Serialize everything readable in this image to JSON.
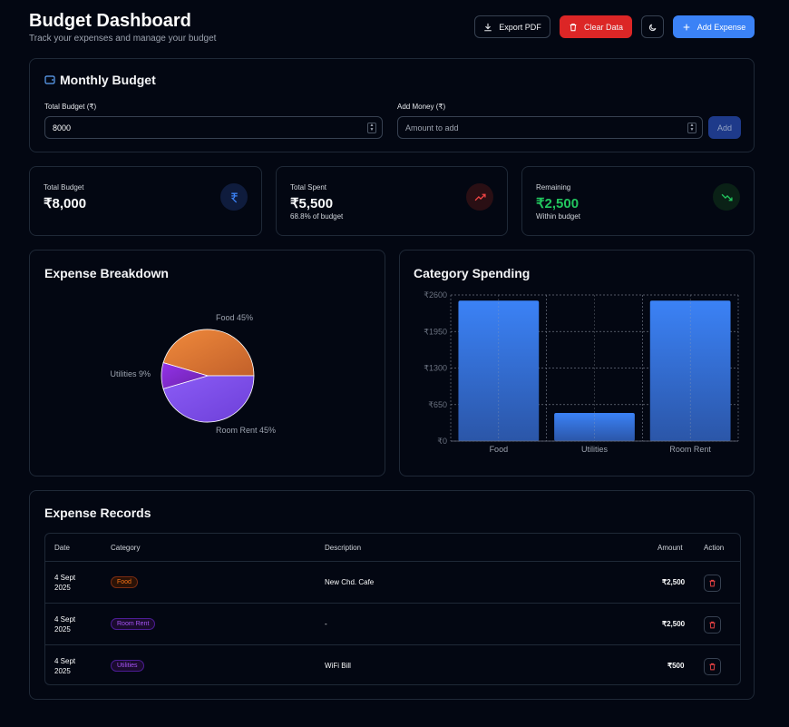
{
  "header": {
    "title": "Budget Dashboard",
    "subtitle": "Track your expenses and manage your budget",
    "export_label": "Export PDF",
    "clear_label": "Clear Data",
    "add_label": "Add Expense"
  },
  "budget": {
    "title": "Monthly Budget",
    "total_label": "Total Budget (₹)",
    "total_value": "8000",
    "add_money_label": "Add Money (₹)",
    "add_money_placeholder": "Amount to add",
    "add_button": "Add"
  },
  "stats": [
    {
      "label": "Total Budget",
      "value": "₹8,000",
      "sub": "",
      "color": "#ffffff",
      "icon": "rupee-icon"
    },
    {
      "label": "Total Spent",
      "value": "₹5,500",
      "sub": "68.8% of budget",
      "color": "#ffffff",
      "icon": "trending-up-icon"
    },
    {
      "label": "Remaining",
      "value": "₹2,500",
      "sub": "Within budget",
      "color": "#22c55e",
      "icon": "trending-down-icon"
    }
  ],
  "breakdown": {
    "title": "Expense Breakdown",
    "slices": [
      {
        "label": "Food 45%",
        "value": 45,
        "color": "#ea7a2f"
      },
      {
        "label": "Room Rent 45%",
        "value": 45,
        "color": "#8b5cf6"
      },
      {
        "label": "Utilities 9%",
        "value": 9,
        "color": "#7e22ce"
      }
    ]
  },
  "spending": {
    "title": "Category Spending"
  },
  "chart_data": {
    "type": "bar",
    "categories": [
      "Food",
      "Utilities",
      "Room Rent"
    ],
    "values": [
      2500,
      500,
      2500
    ],
    "ylim": [
      0,
      2600
    ],
    "yticks": [
      "₹0",
      "₹650",
      "₹1300",
      "₹1950",
      "₹2600"
    ],
    "grid": true
  },
  "records": {
    "title": "Expense Records",
    "columns": [
      "Date",
      "Category",
      "Description",
      "Amount",
      "Action"
    ],
    "rows": [
      {
        "date1": "4 Sept",
        "date2": "2025",
        "category": "Food",
        "description": "New Chd. Cafe",
        "amount": "₹2,500"
      },
      {
        "date1": "4 Sept",
        "date2": "2025",
        "category": "Room Rent",
        "description": "-",
        "amount": "₹2,500"
      },
      {
        "date1": "4 Sept",
        "date2": "2025",
        "category": "Utilities",
        "description": "WiFi Bill",
        "amount": "₹500"
      }
    ]
  },
  "colors": {
    "accent": "#3b82f6",
    "danger": "#dc2626",
    "success": "#22c55e"
  }
}
